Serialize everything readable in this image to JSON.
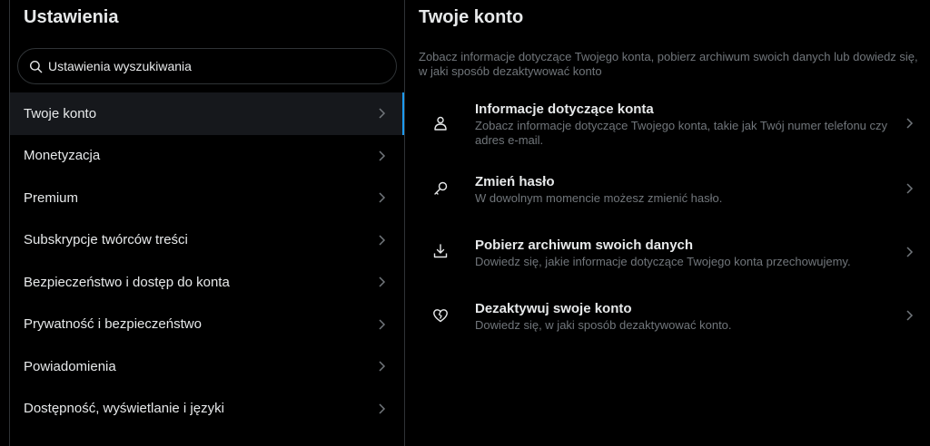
{
  "sidebar": {
    "title": "Ustawienia",
    "search_placeholder": "Ustawienia wyszukiwania",
    "items": [
      {
        "label": "Twoje konto",
        "active": true
      },
      {
        "label": "Monetyzacja"
      },
      {
        "label": "Premium"
      },
      {
        "label": "Subskrypcje twórców treści"
      },
      {
        "label": "Bezpieczeństwo i dostęp do konta"
      },
      {
        "label": "Prywatność i bezpieczeństwo"
      },
      {
        "label": "Powiadomienia"
      },
      {
        "label": "Dostępność, wyświetlanie i języki"
      }
    ]
  },
  "main": {
    "title": "Twoje konto",
    "description": "Zobacz informacje dotyczące Twojego konta, pobierz archiwum swoich danych lub dowiedz się, w jaki sposób dezaktywować konto",
    "options": [
      {
        "icon": "person-icon",
        "title": "Informacje dotyczące konta",
        "subtitle": "Zobacz informacje dotyczące Twojego konta, takie jak Twój numer telefonu czy adres e-mail."
      },
      {
        "icon": "key-icon",
        "title": "Zmień hasło",
        "subtitle": "W dowolnym momencie możesz zmienić hasło."
      },
      {
        "icon": "download-icon",
        "title": "Pobierz archiwum swoich danych",
        "subtitle": "Dowiedz się, jakie informacje dotyczące Twojego konta przechowujemy."
      },
      {
        "icon": "broken-heart-icon",
        "title": "Dezaktywuj swoje konto",
        "subtitle": "Dowiedz się, w jaki sposób dezaktywować konto."
      }
    ]
  },
  "colors": {
    "background": "#000000",
    "text": "#e7e9ea",
    "secondary_text": "#71767b",
    "accent": "#1d9bf0",
    "active_row": "#16181c",
    "border": "#2f3336"
  }
}
